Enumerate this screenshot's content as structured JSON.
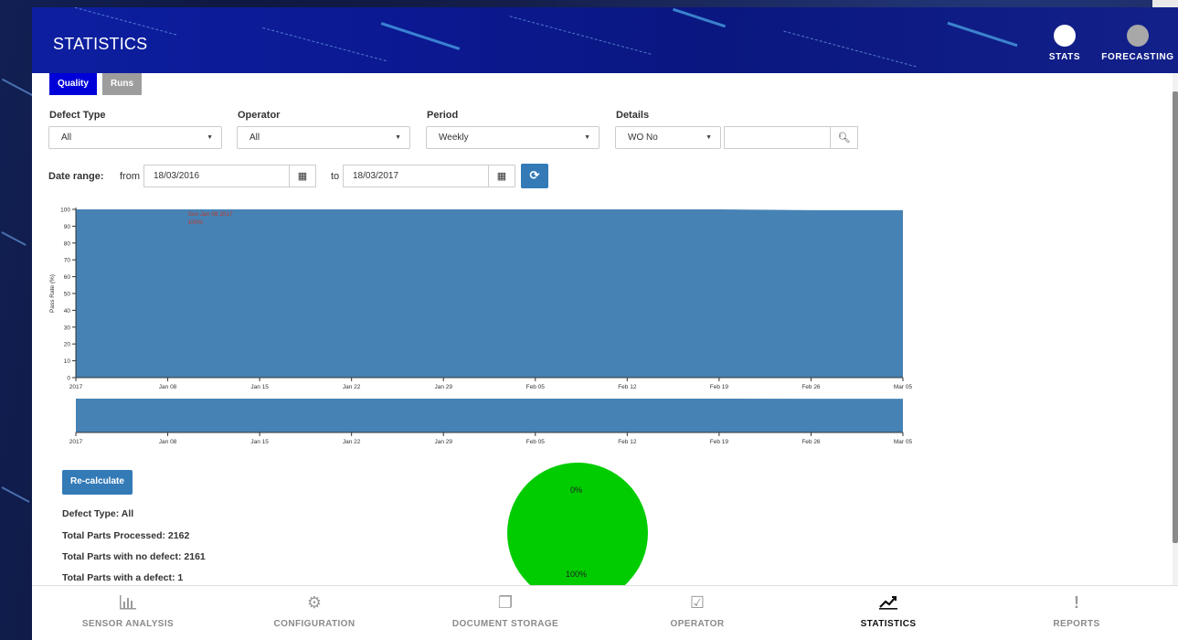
{
  "header": {
    "title": "STATISTICS",
    "modes": [
      {
        "label": "STATS",
        "active": true
      },
      {
        "label": "FORECASTING",
        "active": false
      }
    ]
  },
  "tabs": [
    {
      "label": "Quality",
      "active": true
    },
    {
      "label": "Runs",
      "active": false
    }
  ],
  "filters": {
    "defect_type": {
      "label": "Defect Type",
      "value": "All"
    },
    "operator": {
      "label": "Operator",
      "value": "All"
    },
    "period": {
      "label": "Period",
      "value": "Weekly"
    },
    "details": {
      "label": "Details",
      "value": "WO No",
      "search_value": ""
    }
  },
  "date_range": {
    "label": "Date range:",
    "from_label": "from",
    "from": "18/03/2016",
    "to_label": "to",
    "to": "18/03/2017"
  },
  "chart_data": {
    "type": "area",
    "ylabel": "Pass Rate (%)",
    "ylim": [
      0,
      100
    ],
    "yticks": [
      0,
      10,
      20,
      30,
      40,
      50,
      60,
      70,
      80,
      90,
      100
    ],
    "xticks": [
      "2017",
      "Jan 08",
      "Jan 15",
      "Jan 22",
      "Jan 29",
      "Feb 05",
      "Feb 12",
      "Feb 19",
      "Feb 26",
      "Mar 05"
    ],
    "x": [
      "2017-01-01",
      "2017-01-08",
      "2017-01-15",
      "2017-01-22",
      "2017-01-29",
      "2017-02-05",
      "2017-02-12",
      "2017-02-19",
      "2017-02-26",
      "2017-03-05"
    ],
    "values": [
      100,
      100,
      100,
      100,
      100,
      100,
      100,
      100,
      99.5,
      99.5
    ],
    "tooltip": {
      "date": "Sun Jan 08 2017",
      "value": "100%"
    },
    "color": "#4682b4"
  },
  "summary": {
    "recalculate_label": "Re-calculate",
    "defect_type": "Defect Type: All",
    "total_processed": "Total Parts Processed: 2162",
    "no_defect": "Total Parts with no defect: 2161",
    "with_defect": "Total Parts with a defect: 1"
  },
  "pie": {
    "label_top": "0%",
    "label_bottom": "100%",
    "color": "#00cc00"
  },
  "nav": [
    {
      "label": "SENSOR ANALYSIS",
      "icon": "bar-chart-icon",
      "active": false
    },
    {
      "label": "CONFIGURATION",
      "icon": "gears-icon",
      "active": false
    },
    {
      "label": "DOCUMENT STORAGE",
      "icon": "documents-icon",
      "active": false
    },
    {
      "label": "OPERATOR",
      "icon": "checkbox-icon",
      "active": false
    },
    {
      "label": "STATISTICS",
      "icon": "line-chart-icon",
      "active": true
    },
    {
      "label": "REPORTS",
      "icon": "exclamation-icon",
      "active": false
    }
  ]
}
